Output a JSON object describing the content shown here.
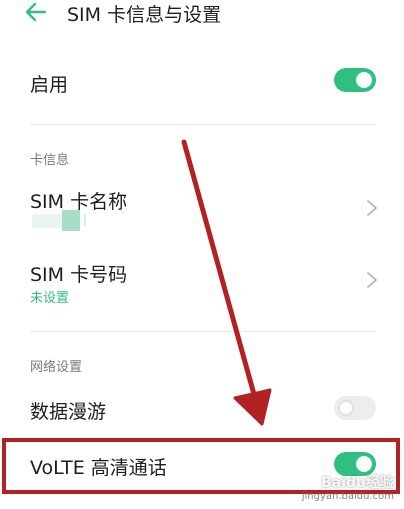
{
  "header": {
    "title": "SIM 卡信息与设置",
    "back_icon": "back-arrow-icon"
  },
  "colors": {
    "accent": "#2fbf7f",
    "toggle_off": "#ededed",
    "annotation_red": "#b32222"
  },
  "enable_row": {
    "label": "启用",
    "toggle_on": true
  },
  "card_info": {
    "section_label": "卡信息",
    "sim_name": {
      "label": "SIM 卡名称",
      "value_icon": "blurred-name-mask"
    },
    "sim_number": {
      "label": "SIM 卡号码",
      "value": "未设置"
    }
  },
  "network": {
    "section_label": "网络设置",
    "data_roaming": {
      "label": "数据漫游",
      "toggle_on": false
    },
    "volte": {
      "label": "VoLTE 高清通话",
      "toggle_on": true
    }
  },
  "watermark": {
    "brand": "Baidu经验",
    "url": "jingyan.baidu.com"
  }
}
